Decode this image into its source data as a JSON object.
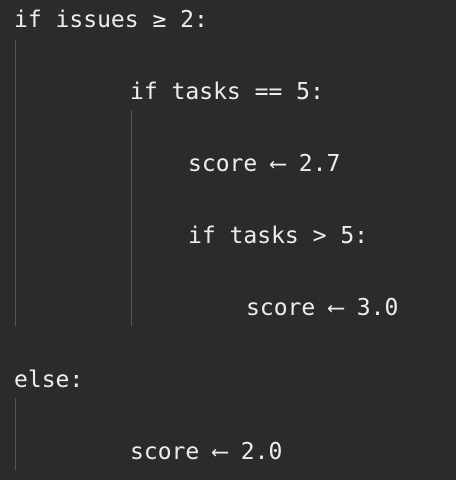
{
  "code": {
    "lines": [
      "if issues ≥ 2:",
      "if tasks == 5:",
      "score ⟵ 2.7",
      "if tasks > 5:",
      "score ⟵ 3.0",
      "else:",
      "score ⟵ 2.0"
    ]
  },
  "colors": {
    "background": "#2b2b2b",
    "text": "#ececec",
    "indent_guide": "#555555"
  }
}
